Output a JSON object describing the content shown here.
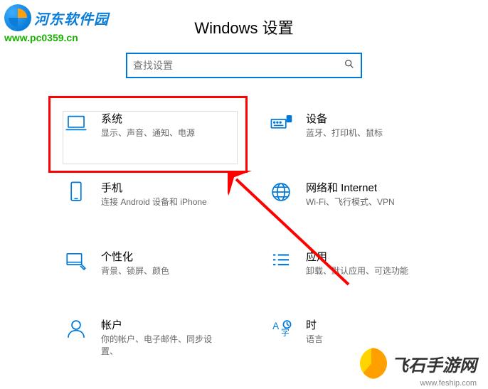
{
  "header": {
    "title": "Windows 设置"
  },
  "search": {
    "placeholder": "查找设置"
  },
  "tiles": {
    "system": {
      "title": "系统",
      "desc": "显示、声音、通知、电源"
    },
    "devices": {
      "title": "设备",
      "desc": "蓝牙、打印机、鼠标"
    },
    "phone": {
      "title": "手机",
      "desc": "连接 Android 设备和 iPhone"
    },
    "network": {
      "title": "网络和 Internet",
      "desc": "Wi-Fi、飞行模式、VPN"
    },
    "personal": {
      "title": "个性化",
      "desc": "背景、锁屏、颜色"
    },
    "apps": {
      "title": "应用",
      "desc": "卸载、默认应用、可选功能"
    },
    "accounts": {
      "title": "帐户",
      "desc": "你的帐户、电子邮件、同步设置、"
    },
    "time": {
      "title": "时",
      "desc": "语言"
    }
  },
  "watermark": {
    "left_text": "河东软件园",
    "left_url": "www.pc0359.cn",
    "right_text": "飞石手游网",
    "right_url": "www.feship.com"
  }
}
